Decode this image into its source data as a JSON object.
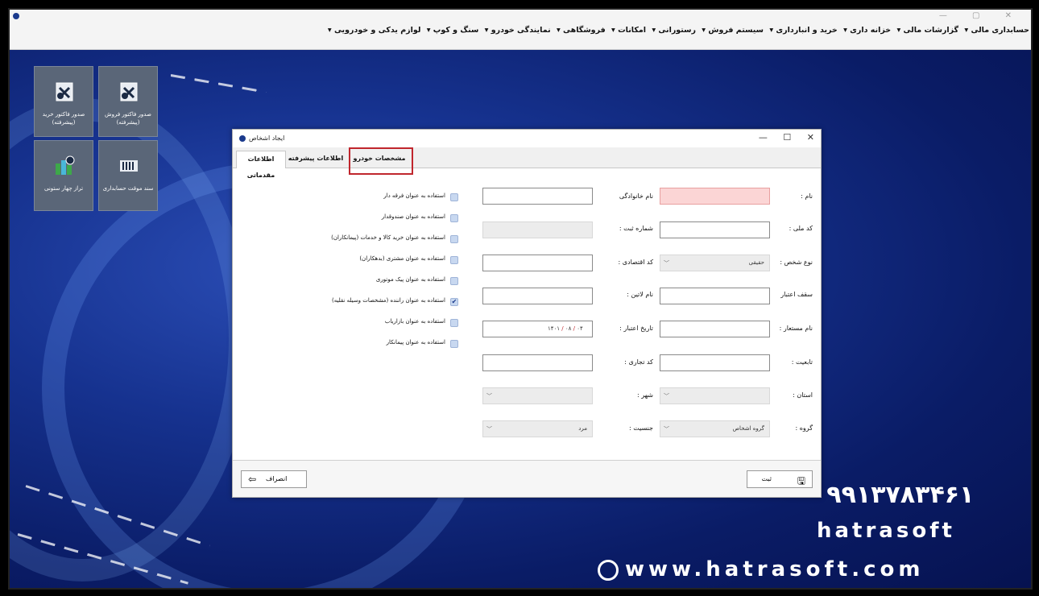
{
  "window": {
    "controls": "— ▢ ✕"
  },
  "menubar": {
    "items": [
      "حسابداری مالی ▾",
      "گزارشات مالی ▾",
      "خزانه داری ▾",
      "خرید و انبارداری ▾",
      "سیستم فروش ▾",
      "رستورانی ▾",
      "امکانات ▾",
      "فروشگاهی ▾",
      "نمایندگی خودرو ▾",
      "سنگ و کوپ ▾",
      "لوازم یدکی و خودرویی ▾"
    ]
  },
  "tiles": [
    {
      "label": "صدور فاکتور خرید (پیشرفته)",
      "icon": "purchase-invoice-icon"
    },
    {
      "label": "صدور فاکتور فروش (پیشرفته)",
      "icon": "sales-invoice-icon"
    },
    {
      "label": "تراز چهار ستونی",
      "icon": "trial-balance-icon"
    },
    {
      "label": "سند موقت حسابداری",
      "icon": "accounting-voucher-icon"
    }
  ],
  "branding": {
    "phone": "۰۹۹۱۳۷۸۳۴۶۱",
    "name": "hatrasoft",
    "site": "www.hatrasoft.com"
  },
  "dialog": {
    "title": "ایجاد اشخاص",
    "controls": {
      "minimize": "—",
      "maximize": "☐",
      "close": "✕"
    },
    "tabs": {
      "basic": "اطلاعات مقدماتی",
      "advanced": "اطلاعات پیشرفته",
      "car": "مشخصات خودرو"
    },
    "fields": {
      "name_label": "نام :",
      "family_label": "نام خانوادگی",
      "national_code_label": "کد ملی :",
      "reg_number_label": "شماره ثبت :",
      "person_type_label": "نوع شخص :",
      "person_type_value": "حقیقی",
      "economic_code_label": "کد اقتصادی :",
      "credit_limit_label": "سقف اعتبار",
      "latin_name_label": "نام لاتین :",
      "alias_label": "نام مستعار :",
      "credit_date_label": "تاریخ اعتبار :",
      "credit_date_parts": [
        "۱۴۰۱",
        "۰۸",
        "۰۴"
      ],
      "nationality_label": "تابعیت :",
      "commercial_code_label": "کد تجاری :",
      "province_label": "استان :",
      "city_label": "شهر :",
      "group_label": "گروه :",
      "group_value": "گروه اشخاص",
      "gender_label": "جنسیت :",
      "gender_value": "مرد"
    },
    "checkboxes": [
      {
        "label": "استفاده به عنوان فرقه دار",
        "checked": false
      },
      {
        "label": "استفاده به عنوان صندوقدار",
        "checked": false
      },
      {
        "label": "استفاده به عنوان خرید کالا و خدمات (پیمانکاران)",
        "checked": false
      },
      {
        "label": "استفاده به عنوان مشتری (بدهکاران)",
        "checked": false
      },
      {
        "label": "استفاده به عنوان پیک موتوری",
        "checked": false
      },
      {
        "label": "استفاده به عنوان راننده (مشخصات وسیله نقلیه)",
        "checked": true
      },
      {
        "label": "استفاده به عنوان بازاریاب",
        "checked": false
      },
      {
        "label": "استفاده به عنوان پیمانکار",
        "checked": false
      }
    ],
    "buttons": {
      "submit": "ثبت",
      "cancel": "انصراف"
    }
  }
}
